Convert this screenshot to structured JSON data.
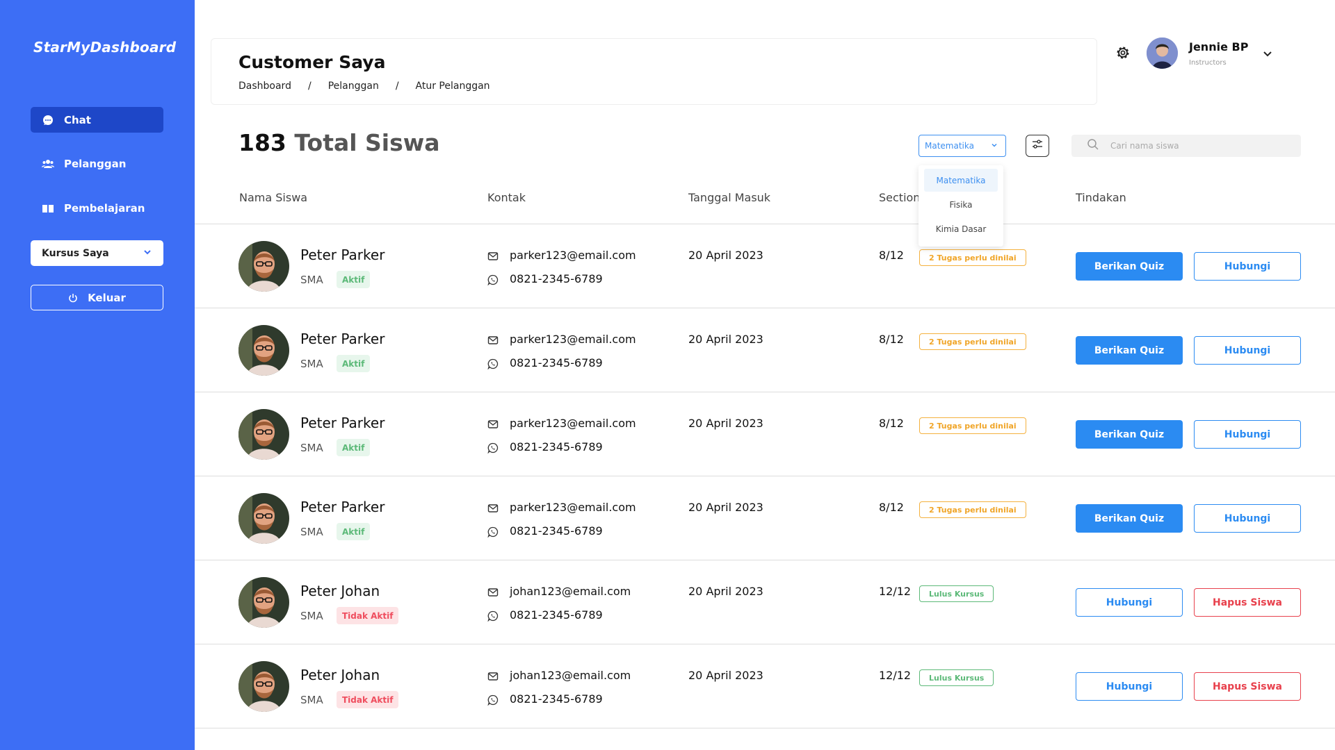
{
  "sidebar": {
    "brand": "StarMyDashboard",
    "nav": [
      {
        "label": "Chat",
        "icon": "chat-bubble-icon",
        "active": true
      },
      {
        "label": "Pelanggan",
        "icon": "users-icon",
        "active": false
      },
      {
        "label": "Pembelajaran",
        "icon": "book-icon",
        "active": false
      }
    ],
    "course_select": {
      "label": "Kursus Saya",
      "icon": "chevron-down-icon"
    },
    "logout": {
      "label": "Keluar",
      "icon": "power-icon"
    }
  },
  "header": {
    "title": "Customer Saya",
    "breadcrumb": [
      "Dashboard",
      "Pelanggan",
      "Atur Pelanggan"
    ],
    "breadcrumb_separator": "/"
  },
  "user": {
    "name": "Jennie BP",
    "role": "Instructors"
  },
  "summary": {
    "count": "183",
    "label": "Total Siswa"
  },
  "filters": {
    "subject_selected": "Matematika",
    "subject_options": [
      "Matematika",
      "Fisika",
      "Kimia Dasar"
    ],
    "search_placeholder": "Cari nama siswa"
  },
  "table": {
    "columns": [
      "Nama Siswa",
      "Kontak",
      "Tanggal Masuk",
      "Section",
      "Tindakan"
    ],
    "rows": [
      {
        "name": "Peter Parker",
        "level": "SMA",
        "status": "Aktif",
        "email": "parker123@email.com",
        "phone": "0821-2345-6789",
        "date": "20 April 2023",
        "section": "8/12",
        "tag": "2 Tugas perlu dinilai",
        "action_1": "Berikan Quiz",
        "action_2": "Hubungi"
      },
      {
        "name": "Peter Parker",
        "level": "SMA",
        "status": "Aktif",
        "email": "parker123@email.com",
        "phone": "0821-2345-6789",
        "date": "20 April 2023",
        "section": "8/12",
        "tag": "2 Tugas perlu dinilai",
        "action_1": "Berikan Quiz",
        "action_2": "Hubungi"
      },
      {
        "name": "Peter Parker",
        "level": "SMA",
        "status": "Aktif",
        "email": "parker123@email.com",
        "phone": "0821-2345-6789",
        "date": "20 April 2023",
        "section": "8/12",
        "tag": "2 Tugas perlu dinilai",
        "action_1": "Berikan Quiz",
        "action_2": "Hubungi"
      },
      {
        "name": "Peter Parker",
        "level": "SMA",
        "status": "Aktif",
        "email": "parker123@email.com",
        "phone": "0821-2345-6789",
        "date": "20 April 2023",
        "section": "8/12",
        "tag": "2 Tugas perlu dinilai",
        "action_1": "Berikan Quiz",
        "action_2": "Hubungi"
      },
      {
        "name": "Peter Johan",
        "level": "SMA",
        "status": "Tidak Aktif",
        "email": "johan123@email.com",
        "phone": "0821-2345-6789",
        "date": "20 April 2023",
        "section": "12/12",
        "tag": "Lulus Kursus",
        "action_1": "Hubungi",
        "action_2": "Hapus Siswa"
      },
      {
        "name": "Peter Johan",
        "level": "SMA",
        "status": "Tidak Aktif",
        "email": "johan123@email.com",
        "phone": "0821-2345-6789",
        "date": "20 April 2023",
        "section": "12/12",
        "tag": "Lulus Kursus",
        "action_1": "Hubungi",
        "action_2": "Hapus Siswa"
      }
    ]
  },
  "colors": {
    "sidebar": "#3d6ef5",
    "nav_active": "#1e47c8",
    "primary_button": "#2b8bf2",
    "danger": "#e8404c",
    "warning_tag": "#f0a528",
    "success": "#5cb978"
  }
}
